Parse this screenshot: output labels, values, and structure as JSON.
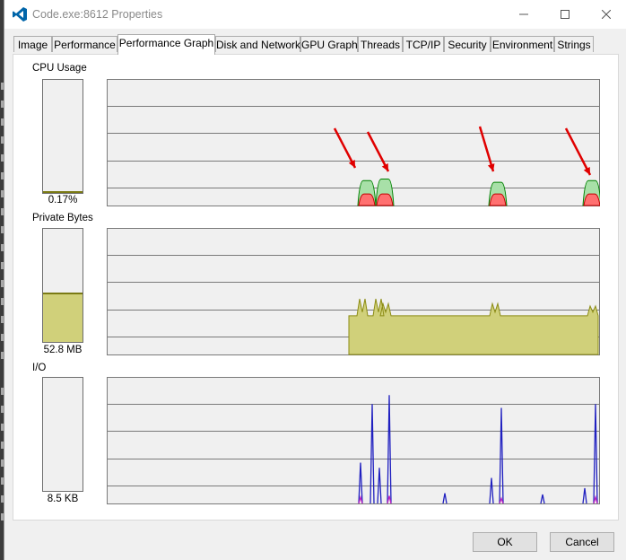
{
  "window": {
    "title": "Code.exe:8612 Properties",
    "app_icon": "vscode-icon",
    "accent_color": "#0065a9"
  },
  "tabs": [
    {
      "label": "Image"
    },
    {
      "label": "Performance"
    },
    {
      "label": "Performance Graph",
      "active": true
    },
    {
      "label": "Disk and Network"
    },
    {
      "label": "GPU Graph"
    },
    {
      "label": "Threads"
    },
    {
      "label": "TCP/IP"
    },
    {
      "label": "Security"
    },
    {
      "label": "Environment"
    },
    {
      "label": "Strings"
    }
  ],
  "cpu": {
    "label": "CPU Usage",
    "value": "0.17%",
    "history_percent": [
      0,
      0,
      0,
      0,
      0,
      0,
      0,
      0,
      0,
      0,
      0,
      0,
      0,
      0,
      0,
      0,
      0,
      0,
      0,
      0,
      0,
      0,
      0,
      0,
      0,
      0,
      0,
      0,
      0,
      0,
      0,
      0,
      0,
      0,
      0,
      0,
      0,
      0,
      0,
      0,
      0,
      0,
      0,
      0,
      0,
      0,
      0,
      0,
      0,
      0,
      0,
      0,
      0,
      0,
      0,
      0,
      0,
      0,
      0,
      0,
      0,
      0,
      0,
      0,
      0,
      0,
      0,
      0,
      0,
      0,
      0,
      0,
      0,
      0,
      0,
      0,
      0,
      0,
      0,
      0,
      0,
      0,
      0,
      0,
      0,
      0,
      0,
      0,
      0,
      0,
      0,
      0,
      0,
      0,
      0,
      0,
      0,
      0,
      0,
      0,
      0,
      0,
      0,
      0,
      0,
      0,
      0,
      0,
      0,
      0,
      0,
      0,
      0,
      0,
      0,
      0,
      0,
      0,
      0,
      0,
      0,
      0,
      0,
      0,
      0,
      0,
      0,
      0,
      0,
      0,
      0,
      0,
      0,
      0,
      0,
      0,
      0,
      0,
      0,
      0,
      0,
      0,
      0,
      0,
      0,
      0,
      0,
      0,
      0,
      0,
      0,
      0,
      0,
      0,
      0,
      0,
      0,
      0,
      0,
      0,
      0,
      0,
      0,
      0,
      0,
      0,
      0,
      0,
      0,
      0,
      0,
      0,
      0,
      0,
      0,
      0,
      0,
      0,
      0,
      0,
      0,
      0,
      0,
      0,
      0,
      0,
      0,
      0,
      0,
      0,
      0,
      0,
      0,
      0,
      0,
      0,
      0,
      0,
      0,
      0,
      0,
      0,
      0,
      0,
      0,
      0,
      0,
      0,
      0,
      0,
      0,
      0,
      0,
      0,
      0,
      0,
      0,
      0,
      0,
      0,
      0,
      0,
      0,
      0,
      0,
      0,
      0,
      0,
      0,
      0,
      0,
      0,
      0,
      0,
      0,
      0,
      0,
      0,
      0,
      0,
      0,
      0,
      0,
      0,
      0,
      0,
      0,
      0,
      0,
      0,
      0,
      0,
      0,
      0,
      0,
      0,
      0,
      0,
      0,
      0,
      0,
      0,
      0,
      0,
      0,
      0,
      0,
      0,
      0,
      0,
      0,
      0,
      0,
      0,
      0,
      0,
      0,
      0,
      0,
      0,
      0,
      0,
      0,
      0,
      0,
      0,
      0,
      0,
      0,
      0,
      0,
      0,
      0,
      0,
      0,
      0,
      0,
      0,
      0,
      0,
      0,
      0,
      0,
      0,
      0,
      0,
      0,
      0,
      0,
      0,
      0,
      0,
      0,
      0,
      0,
      0,
      0,
      0,
      0,
      0,
      0,
      0,
      0,
      0,
      0,
      0,
      0,
      0,
      0,
      0,
      0,
      0,
      0,
      0,
      0,
      0,
      0,
      0,
      0,
      0,
      0,
      0,
      0,
      0,
      0,
      0,
      0,
      0,
      0,
      0,
      0,
      0,
      0,
      0,
      0,
      0,
      0,
      0,
      0,
      0,
      0,
      0,
      0,
      0,
      0,
      0,
      0,
      0,
      0,
      0,
      0,
      0,
      0,
      0,
      0,
      0,
      0,
      0,
      0,
      0,
      0,
      0,
      0,
      0,
      0,
      0,
      0,
      0,
      0,
      0,
      0,
      0,
      0,
      0,
      0,
      0,
      0,
      0,
      0,
      0,
      0,
      0,
      0,
      0,
      0,
      0,
      0,
      0,
      0,
      0,
      0,
      0,
      0,
      0,
      0,
      0,
      0,
      0,
      0,
      0,
      0,
      0,
      0,
      0,
      0,
      0,
      0,
      0,
      0,
      0,
      0,
      0,
      0,
      0,
      0,
      0,
      0,
      0,
      0,
      0,
      0,
      0,
      0,
      0,
      0,
      0,
      0,
      0,
      0,
      0,
      0,
      0,
      0,
      0,
      0,
      0,
      0,
      0,
      0,
      0,
      0,
      0,
      0,
      0,
      0,
      0,
      0,
      0,
      0,
      0,
      0,
      0,
      0,
      0,
      0,
      0,
      0,
      0,
      0,
      0,
      0,
      0,
      0,
      0,
      0,
      0,
      0,
      0,
      0,
      0,
      0,
      0,
      0,
      0,
      0,
      0,
      0,
      0,
      0,
      0,
      0,
      0,
      0,
      0,
      0,
      0,
      0,
      0,
      0,
      0,
      0,
      0,
      0,
      0,
      0,
      0,
      0,
      0,
      0,
      0,
      0,
      0,
      0,
      0,
      0,
      0,
      0,
      0,
      0,
      0,
      0,
      0,
      0,
      0,
      0,
      0,
      0,
      0,
      0,
      0,
      0,
      0,
      0,
      0,
      0,
      0,
      0,
      0,
      0,
      0,
      0,
      0,
      0,
      0,
      0,
      0,
      0,
      0,
      0,
      0,
      0,
      0,
      0,
      0,
      0,
      0,
      0,
      0,
      0,
      0,
      0,
      0,
      0,
      0,
      0,
      0,
      0,
      0,
      0,
      0,
      0,
      0,
      0,
      0,
      0,
      0,
      0,
      0,
      0,
      0,
      0,
      0,
      0,
      0,
      0
    ],
    "spikes": [
      {
        "center": 290,
        "total": 7.5,
        "kernel": 3.5
      },
      {
        "center": 310,
        "total": 8,
        "kernel": 3.5
      },
      {
        "center": 436,
        "total": 7,
        "kernel": 3.5
      },
      {
        "center": 541,
        "total": 7.5,
        "kernel": 3.5
      }
    ],
    "colors": {
      "total": "#008000",
      "total_fill": "#a8e0a8",
      "kernel": "#c00000",
      "kernel_fill": "#ff7070"
    }
  },
  "private_bytes": {
    "label": "Private Bytes",
    "value": "52.8 MB",
    "gauge_level": 0.44,
    "segments": [
      {
        "from": 0,
        "to": 270,
        "level": 0
      },
      {
        "from": 270,
        "to": 548,
        "level": 0.16
      }
    ],
    "bumps": [
      {
        "center": 285,
        "height": 0.07
      },
      {
        "center": 303,
        "height": 0.07
      },
      {
        "center": 311,
        "height": 0.05
      },
      {
        "center": 433,
        "height": 0.05
      },
      {
        "center": 542,
        "height": 0.04
      }
    ],
    "colors": {
      "line": "#8c8c14",
      "fill": "#d0d07a"
    }
  },
  "io": {
    "label": "I/O",
    "value": "8.5  KB",
    "spikes": [
      {
        "center": 283,
        "height": 0.32,
        "color": "#2020c0"
      },
      {
        "center": 296,
        "height": 0.78,
        "color": "#2020c0"
      },
      {
        "center": 304,
        "height": 0.28,
        "color": "#2020c0"
      },
      {
        "center": 315,
        "height": 0.85,
        "color": "#2020c0"
      },
      {
        "center": 377,
        "height": 0.08,
        "color": "#2020c0"
      },
      {
        "center": 429,
        "height": 0.2,
        "color": "#2020c0"
      },
      {
        "center": 440,
        "height": 0.75,
        "color": "#2020c0"
      },
      {
        "center": 486,
        "height": 0.07,
        "color": "#2020c0"
      },
      {
        "center": 533,
        "height": 0.12,
        "color": "#2020c0"
      },
      {
        "center": 545,
        "height": 0.78,
        "color": "#2020c0"
      },
      {
        "center": 283,
        "height": 0.05,
        "color": "#c020c0"
      },
      {
        "center": 315,
        "height": 0.06,
        "color": "#c020c0"
      },
      {
        "center": 440,
        "height": 0.04,
        "color": "#c020c0"
      },
      {
        "center": 545,
        "height": 0.05,
        "color": "#c020c0"
      }
    ]
  },
  "annotation_color": "#e00000",
  "buttons": {
    "ok": "OK",
    "cancel": "Cancel"
  }
}
